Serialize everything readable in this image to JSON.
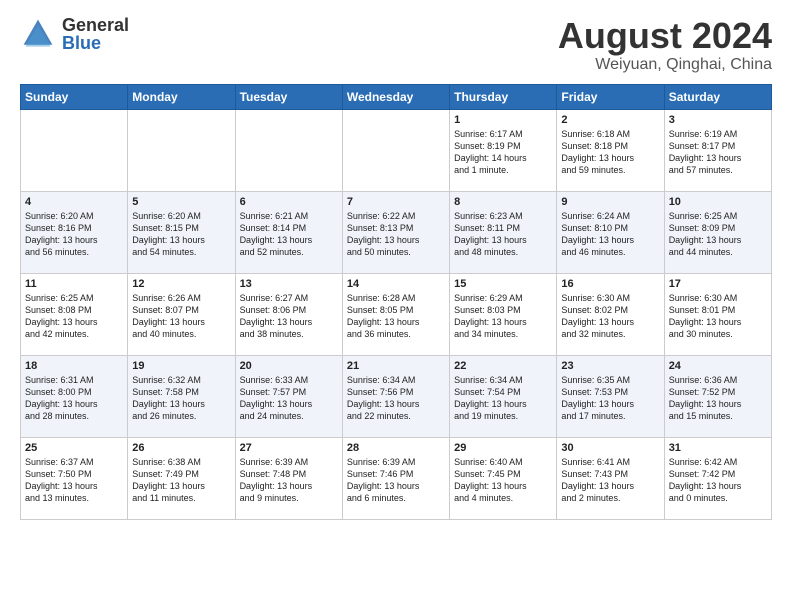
{
  "header": {
    "logo_general": "General",
    "logo_blue": "Blue",
    "title": "August 2024",
    "subtitle": "Weiyuan, Qinghai, China"
  },
  "days_of_week": [
    "Sunday",
    "Monday",
    "Tuesday",
    "Wednesday",
    "Thursday",
    "Friday",
    "Saturday"
  ],
  "weeks": [
    [
      {
        "day": "",
        "info": ""
      },
      {
        "day": "",
        "info": ""
      },
      {
        "day": "",
        "info": ""
      },
      {
        "day": "",
        "info": ""
      },
      {
        "day": "1",
        "info": "Sunrise: 6:17 AM\nSunset: 8:19 PM\nDaylight: 14 hours\nand 1 minute."
      },
      {
        "day": "2",
        "info": "Sunrise: 6:18 AM\nSunset: 8:18 PM\nDaylight: 13 hours\nand 59 minutes."
      },
      {
        "day": "3",
        "info": "Sunrise: 6:19 AM\nSunset: 8:17 PM\nDaylight: 13 hours\nand 57 minutes."
      }
    ],
    [
      {
        "day": "4",
        "info": "Sunrise: 6:20 AM\nSunset: 8:16 PM\nDaylight: 13 hours\nand 56 minutes."
      },
      {
        "day": "5",
        "info": "Sunrise: 6:20 AM\nSunset: 8:15 PM\nDaylight: 13 hours\nand 54 minutes."
      },
      {
        "day": "6",
        "info": "Sunrise: 6:21 AM\nSunset: 8:14 PM\nDaylight: 13 hours\nand 52 minutes."
      },
      {
        "day": "7",
        "info": "Sunrise: 6:22 AM\nSunset: 8:13 PM\nDaylight: 13 hours\nand 50 minutes."
      },
      {
        "day": "8",
        "info": "Sunrise: 6:23 AM\nSunset: 8:11 PM\nDaylight: 13 hours\nand 48 minutes."
      },
      {
        "day": "9",
        "info": "Sunrise: 6:24 AM\nSunset: 8:10 PM\nDaylight: 13 hours\nand 46 minutes."
      },
      {
        "day": "10",
        "info": "Sunrise: 6:25 AM\nSunset: 8:09 PM\nDaylight: 13 hours\nand 44 minutes."
      }
    ],
    [
      {
        "day": "11",
        "info": "Sunrise: 6:25 AM\nSunset: 8:08 PM\nDaylight: 13 hours\nand 42 minutes."
      },
      {
        "day": "12",
        "info": "Sunrise: 6:26 AM\nSunset: 8:07 PM\nDaylight: 13 hours\nand 40 minutes."
      },
      {
        "day": "13",
        "info": "Sunrise: 6:27 AM\nSunset: 8:06 PM\nDaylight: 13 hours\nand 38 minutes."
      },
      {
        "day": "14",
        "info": "Sunrise: 6:28 AM\nSunset: 8:05 PM\nDaylight: 13 hours\nand 36 minutes."
      },
      {
        "day": "15",
        "info": "Sunrise: 6:29 AM\nSunset: 8:03 PM\nDaylight: 13 hours\nand 34 minutes."
      },
      {
        "day": "16",
        "info": "Sunrise: 6:30 AM\nSunset: 8:02 PM\nDaylight: 13 hours\nand 32 minutes."
      },
      {
        "day": "17",
        "info": "Sunrise: 6:30 AM\nSunset: 8:01 PM\nDaylight: 13 hours\nand 30 minutes."
      }
    ],
    [
      {
        "day": "18",
        "info": "Sunrise: 6:31 AM\nSunset: 8:00 PM\nDaylight: 13 hours\nand 28 minutes."
      },
      {
        "day": "19",
        "info": "Sunrise: 6:32 AM\nSunset: 7:58 PM\nDaylight: 13 hours\nand 26 minutes."
      },
      {
        "day": "20",
        "info": "Sunrise: 6:33 AM\nSunset: 7:57 PM\nDaylight: 13 hours\nand 24 minutes."
      },
      {
        "day": "21",
        "info": "Sunrise: 6:34 AM\nSunset: 7:56 PM\nDaylight: 13 hours\nand 22 minutes."
      },
      {
        "day": "22",
        "info": "Sunrise: 6:34 AM\nSunset: 7:54 PM\nDaylight: 13 hours\nand 19 minutes."
      },
      {
        "day": "23",
        "info": "Sunrise: 6:35 AM\nSunset: 7:53 PM\nDaylight: 13 hours\nand 17 minutes."
      },
      {
        "day": "24",
        "info": "Sunrise: 6:36 AM\nSunset: 7:52 PM\nDaylight: 13 hours\nand 15 minutes."
      }
    ],
    [
      {
        "day": "25",
        "info": "Sunrise: 6:37 AM\nSunset: 7:50 PM\nDaylight: 13 hours\nand 13 minutes."
      },
      {
        "day": "26",
        "info": "Sunrise: 6:38 AM\nSunset: 7:49 PM\nDaylight: 13 hours\nand 11 minutes."
      },
      {
        "day": "27",
        "info": "Sunrise: 6:39 AM\nSunset: 7:48 PM\nDaylight: 13 hours\nand 9 minutes."
      },
      {
        "day": "28",
        "info": "Sunrise: 6:39 AM\nSunset: 7:46 PM\nDaylight: 13 hours\nand 6 minutes."
      },
      {
        "day": "29",
        "info": "Sunrise: 6:40 AM\nSunset: 7:45 PM\nDaylight: 13 hours\nand 4 minutes."
      },
      {
        "day": "30",
        "info": "Sunrise: 6:41 AM\nSunset: 7:43 PM\nDaylight: 13 hours\nand 2 minutes."
      },
      {
        "day": "31",
        "info": "Sunrise: 6:42 AM\nSunset: 7:42 PM\nDaylight: 13 hours\nand 0 minutes."
      }
    ]
  ]
}
